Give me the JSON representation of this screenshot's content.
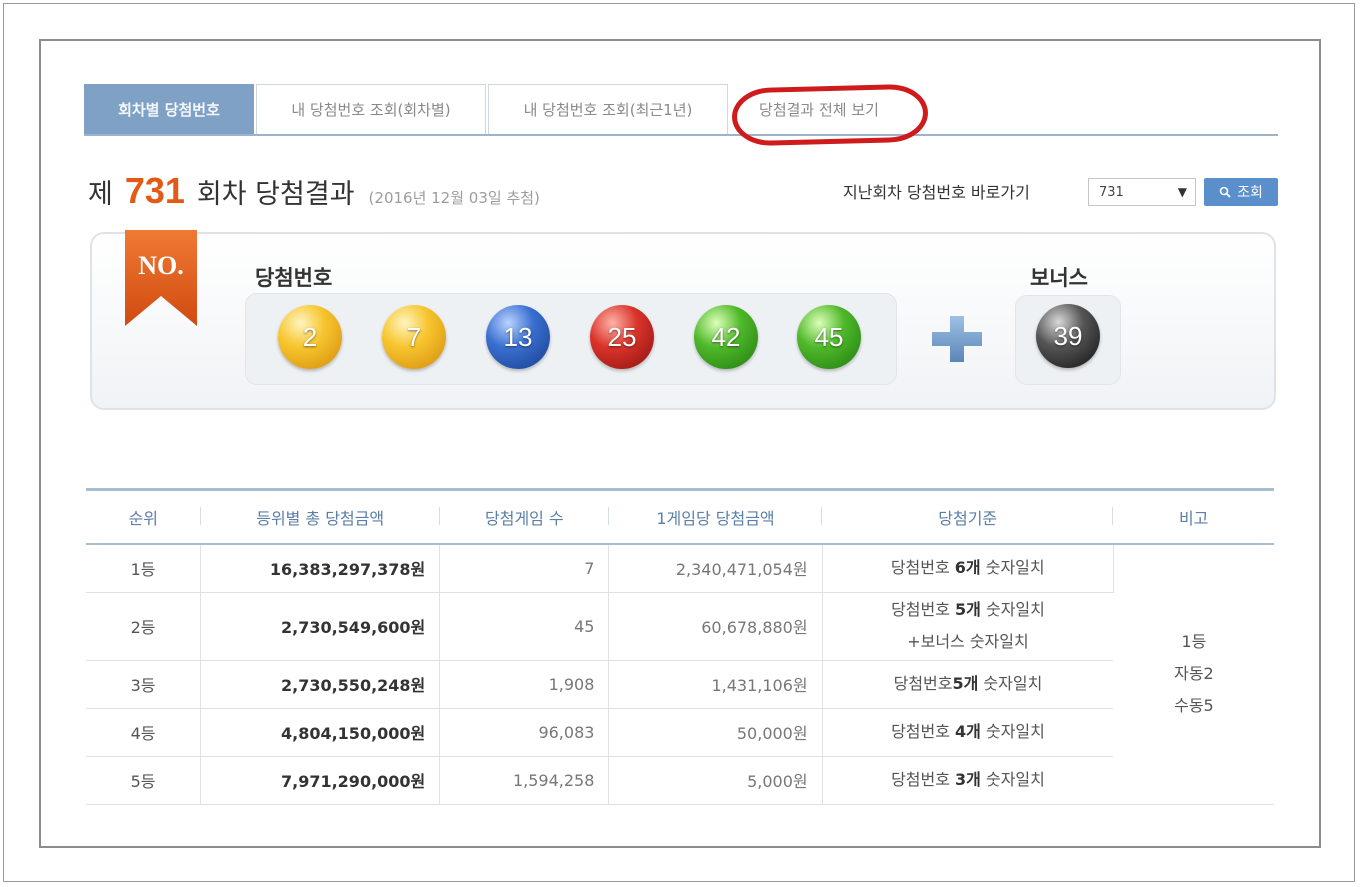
{
  "tabs": [
    {
      "label": "회차별 당첨번호",
      "active": true
    },
    {
      "label": "내 당첨번호 조회(회차별)",
      "active": false
    },
    {
      "label": "내 당첨번호 조회(최근1년)",
      "active": false
    },
    {
      "label": "당첨결과 전체 보기",
      "active": false
    }
  ],
  "title": {
    "prefix": "제",
    "round": "731",
    "suffix": "회차 당첨결과",
    "date": "(2016년 12월 03일 추첨)"
  },
  "jump": {
    "label": "지난회차 당첨번호 바로가기",
    "selected": "731",
    "button": "조회"
  },
  "ribbon_text": "NO.",
  "winning": {
    "label": "당첨번호",
    "numbers": [
      {
        "value": "2",
        "color": "yellow"
      },
      {
        "value": "7",
        "color": "yellow"
      },
      {
        "value": "13",
        "color": "blue"
      },
      {
        "value": "25",
        "color": "red"
      },
      {
        "value": "42",
        "color": "green"
      },
      {
        "value": "45",
        "color": "green"
      }
    ]
  },
  "bonus": {
    "label": "보너스",
    "value": "39",
    "color": "black"
  },
  "table": {
    "headers": [
      "순위",
      "등위별 총 당첨금액",
      "당첨게임 수",
      "1게임당 당첨금액",
      "당첨기준",
      "비고"
    ],
    "rows": [
      {
        "rank": "1등",
        "total": "16,383,297,378원",
        "count": "7",
        "each": "2,340,471,054원",
        "cond": [
          "당첨번호 ",
          "6개",
          " 숫자일치"
        ]
      },
      {
        "rank": "2등",
        "total": "2,730,549,600원",
        "count": "45",
        "each": "60,678,880원",
        "cond": [
          "당첨번호 ",
          "5개",
          " 숫자일치"
        ],
        "cond2": "+보너스 숫자일치"
      },
      {
        "rank": "3등",
        "total": "2,730,550,248원",
        "count": "1,908",
        "each": "1,431,106원",
        "cond": [
          "당첨번호",
          "5개",
          " 숫자일치"
        ]
      },
      {
        "rank": "4등",
        "total": "4,804,150,000원",
        "count": "96,083",
        "each": "50,000원",
        "cond": [
          "당첨번호 ",
          "4개",
          " 숫자일치"
        ]
      },
      {
        "rank": "5등",
        "total": "7,971,290,000원",
        "count": "1,594,258",
        "each": "5,000원",
        "cond": [
          "당첨번호 ",
          "3개",
          " 숫자일치"
        ]
      }
    ],
    "note": [
      "1등",
      "자동2",
      "수동5"
    ]
  }
}
